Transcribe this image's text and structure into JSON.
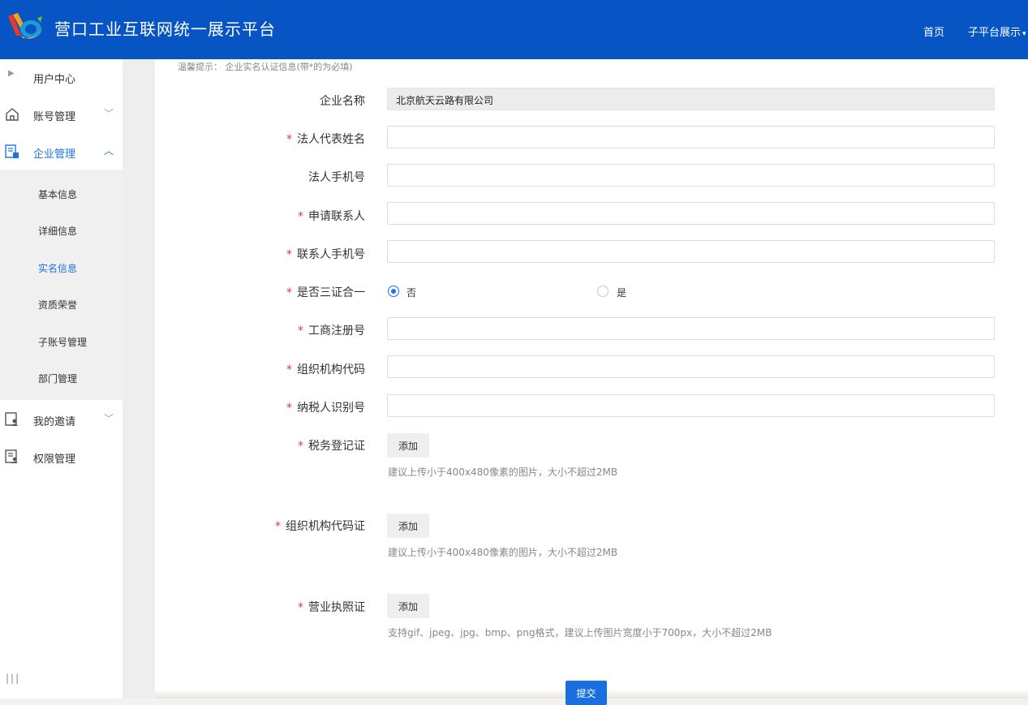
{
  "header": {
    "title": "营口工业互联网统一展示平台",
    "nav": {
      "home": "首页",
      "subplatform": "子平台展示"
    }
  },
  "sidebar": {
    "items": [
      {
        "label": "用户中心"
      },
      {
        "label": "账号管理"
      },
      {
        "label": "企业管理"
      },
      {
        "label": "我的邀请"
      },
      {
        "label": "权限管理"
      }
    ],
    "submenu": [
      {
        "label": "基本信息"
      },
      {
        "label": "详细信息"
      },
      {
        "label": "实名信息"
      },
      {
        "label": "资质荣誉"
      },
      {
        "label": "子账号管理"
      },
      {
        "label": "部门管理"
      }
    ],
    "grip": "|||"
  },
  "form": {
    "tip": "温馨提示：  企业实名认证信息(带*的为必填)",
    "required_mark": "*",
    "company_name": {
      "label": "企业名称",
      "value": "北京航天云路有限公司"
    },
    "legal_name": {
      "label": "法人代表姓名"
    },
    "legal_phone": {
      "label": "法人手机号"
    },
    "applicant": {
      "label": "申请联系人"
    },
    "contact_phone": {
      "label": "联系人手机号"
    },
    "three_in_one": {
      "label": "是否三证合一",
      "options": [
        "否",
        "是"
      ],
      "selected": "否"
    },
    "business_reg": {
      "label": "工商注册号"
    },
    "org_code": {
      "label": "组织机构代码"
    },
    "taxpayer_id": {
      "label": "纳税人识别号"
    },
    "tax_cert": {
      "label": "税务登记证",
      "button": "添加",
      "hint": "建议上传小于400x480像素的图片，大小不超过2MB"
    },
    "org_cert": {
      "label": "组织机构代码证",
      "button": "添加",
      "hint": "建议上传小于400x480像素的图片，大小不超过2MB"
    },
    "license": {
      "label": "营业执照证",
      "button": "添加",
      "hint": "支持gif、jpeg、jpg、bmp、png格式，建议上传图片宽度小于700px，大小不超过2MB"
    },
    "submit": "提交"
  },
  "colors": {
    "header": "#0754c4",
    "accent": "#1a73e8",
    "required": "#e53935"
  }
}
